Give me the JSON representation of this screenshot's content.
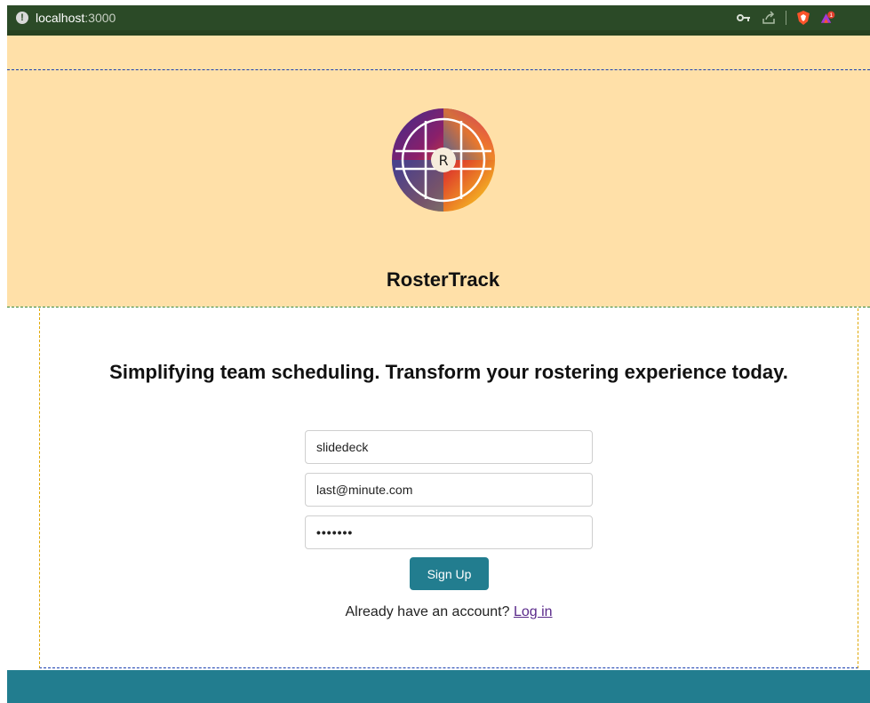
{
  "browser": {
    "url_host": "localhost",
    "url_port": ":3000",
    "icons": [
      "key-icon",
      "share-icon",
      "brave-shield-icon",
      "brave-rewards-icon"
    ],
    "rewards_badge": "1"
  },
  "header": {
    "logo_letter": "R",
    "brand_title": "RosterTrack",
    "background": "#ffe0a8"
  },
  "main": {
    "tagline": "Simplifying team scheduling. Transform your rostering experience today.",
    "form": {
      "username_value": "slidedeck",
      "email_value": "last@minute.com",
      "password_value": "•••••••",
      "submit_label": "Sign Up"
    },
    "login_prompt": "Already have an account?",
    "login_link": "Log in"
  },
  "colors": {
    "browser_bar": "#2b4a27",
    "accent": "#227d8f",
    "link": "#5a2a8a"
  }
}
